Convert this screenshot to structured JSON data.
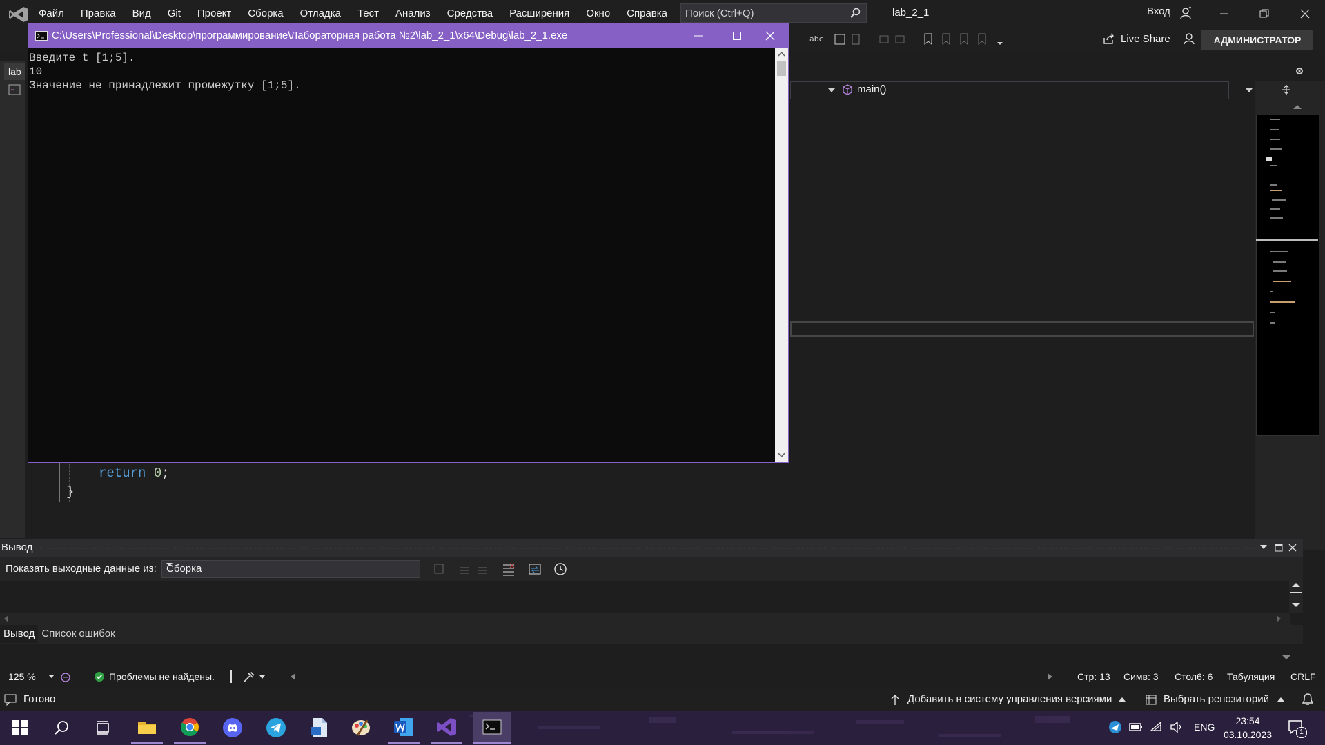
{
  "menu": [
    "Файл",
    "Правка",
    "Вид",
    "Git",
    "Проект",
    "Сборка",
    "Отладка",
    "Тест",
    "Анализ",
    "Средства",
    "Расширения",
    "Окно",
    "Справка"
  ],
  "search": {
    "placeholder": "Поиск (Ctrl+Q)"
  },
  "solution_name": "lab_2_1",
  "signin_label": "Вход",
  "toolbar": {
    "live_share": "Live Share",
    "admin": "АДМИНИСТРАТОР"
  },
  "editor": {
    "file_tab": "lab",
    "nav_function": "main()",
    "code": {
      "return_kw": "return",
      "return_val": "0",
      "semicolon": ";",
      "close_brace": "}"
    }
  },
  "console": {
    "title": "C:\\Users\\Professional\\Desktop\\программирование\\Лабораторная работа №2\\lab_2_1\\x64\\Debug\\lab_2_1.exe",
    "lines": [
      "Введите t [1;5].",
      "10",
      "Значение не принадлежит промежутку [1;5]."
    ]
  },
  "output": {
    "title": "Вывод",
    "show_from_label": "Показать выходные данные из:",
    "source_value": "Сборка",
    "tabs": [
      "Вывод",
      "Список ошибок"
    ]
  },
  "status": {
    "zoom": "125 %",
    "problems": "Проблемы не найдены.",
    "line": "Стр: 13",
    "char": "Симв: 3",
    "col": "Стол6: 6",
    "tabs": "Табуляция",
    "eol": "CRLF"
  },
  "app_status": {
    "ready": "Готово",
    "add_vcs": "Добавить в систему управления версиями",
    "repo": "Выбрать репозиторий"
  },
  "taskbar": {
    "lang": "ENG",
    "time": "23:54",
    "date": "03.10.2023",
    "notifications": "1"
  },
  "colors": {
    "console_accent": "#8660c5",
    "keyword": "#569cd6",
    "number": "#b5cea8",
    "taskbar": "#2a1f3c"
  }
}
